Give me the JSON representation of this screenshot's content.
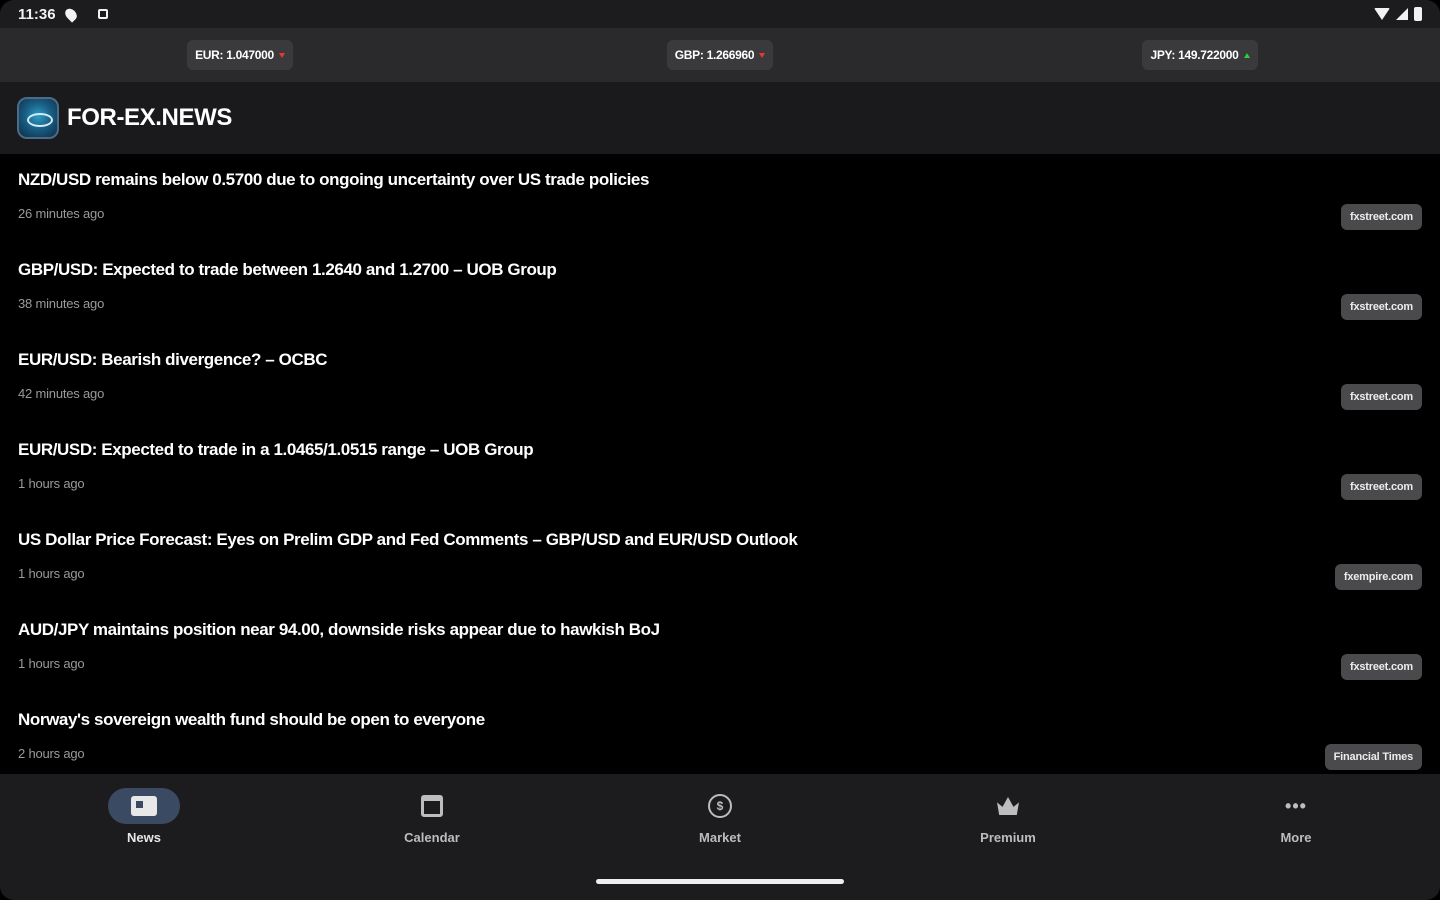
{
  "status_bar": {
    "time": "11:36"
  },
  "ticker": [
    {
      "label": "EUR: 1.047000",
      "trend": "down"
    },
    {
      "label": "GBP: 1.266960",
      "trend": "down"
    },
    {
      "label": "JPY: 149.722000",
      "trend": "up"
    }
  ],
  "app_bar": {
    "title": "FOR-EX.NEWS"
  },
  "news": [
    {
      "title": "NZD/USD remains below 0.5700 due to ongoing uncertainty over US trade policies",
      "time": "26 minutes ago",
      "source": "fxstreet.com"
    },
    {
      "title": "GBP/USD: Expected to trade between 1.2640 and 1.2700 – UOB Group",
      "time": "38 minutes ago",
      "source": "fxstreet.com"
    },
    {
      "title": "EUR/USD: Bearish divergence? – OCBC",
      "time": "42 minutes ago",
      "source": "fxstreet.com"
    },
    {
      "title": "EUR/USD: Expected to trade in a 1.0465/1.0515 range – UOB Group",
      "time": "1 hours ago",
      "source": "fxstreet.com"
    },
    {
      "title": "US Dollar Price Forecast: Eyes on Prelim GDP and Fed Comments – GBP/USD and EUR/USD Outlook",
      "time": "1 hours ago",
      "source": "fxempire.com"
    },
    {
      "title": "AUD/JPY maintains position near 94.00, downside risks appear due to hawkish BoJ",
      "time": "1 hours ago",
      "source": "fxstreet.com"
    },
    {
      "title": "Norway's sovereign wealth fund should be open to everyone",
      "time": "2 hours ago",
      "source": "Financial Times"
    }
  ],
  "bottom_nav": [
    {
      "label": "News",
      "icon": "news-icon",
      "active": true
    },
    {
      "label": "Calendar",
      "icon": "calendar-icon",
      "active": false
    },
    {
      "label": "Market",
      "icon": "market-icon",
      "active": false
    },
    {
      "label": "Premium",
      "icon": "crown-icon",
      "active": false
    },
    {
      "label": "More",
      "icon": "more-icon",
      "active": false
    }
  ],
  "colors": {
    "trend_down": "#e53935",
    "trend_up": "#2ecc40",
    "nav_active": "#3b4a63"
  }
}
